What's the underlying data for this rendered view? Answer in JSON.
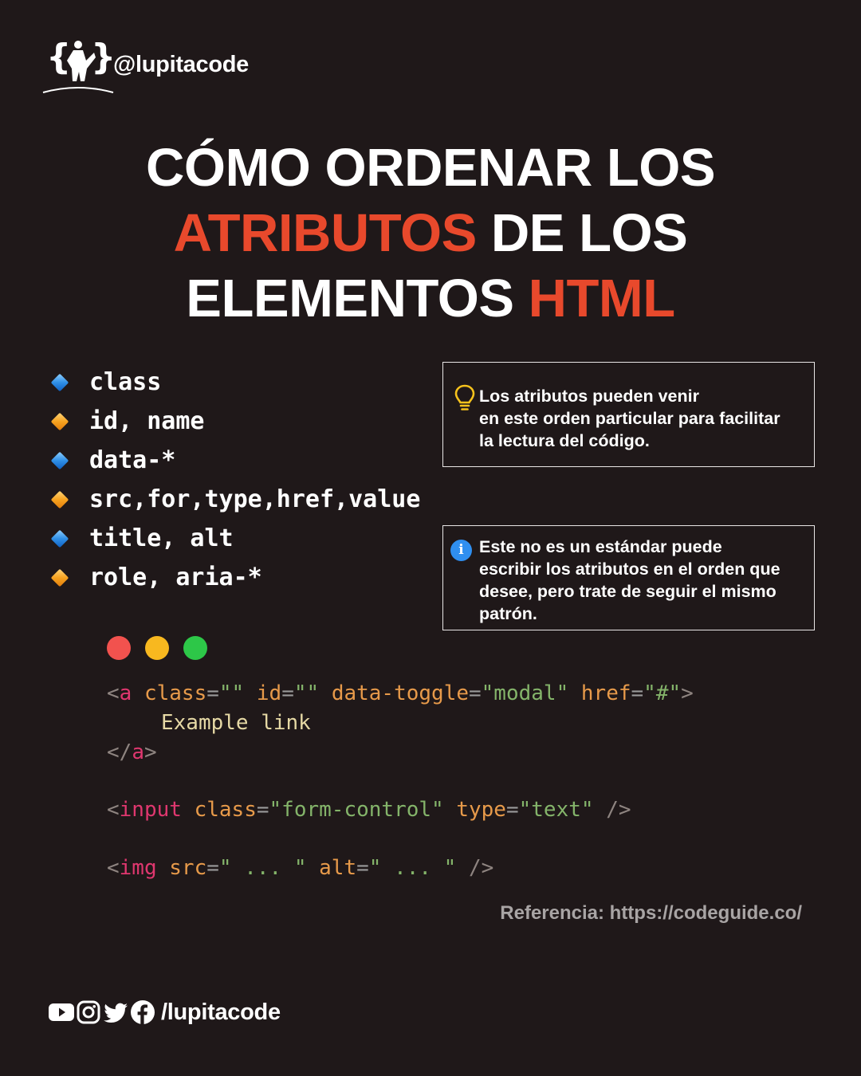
{
  "brand": {
    "handle": "@lupitacode"
  },
  "title": {
    "line1": "CÓMO ORDENAR LOS",
    "line2_accent": "ATRIBUTOS",
    "line2_rest": " DE LOS",
    "line3_rest": "ELEMENTOS ",
    "line3_accent": "HTML"
  },
  "attributes": [
    {
      "text": "class",
      "icon": "blue-diamond-icon"
    },
    {
      "text": "id, name",
      "icon": "orange-diamond-icon"
    },
    {
      "text": "data-*",
      "icon": "blue-diamond-icon"
    },
    {
      "text": "src,for,type,href,value",
      "icon": "orange-diamond-icon"
    },
    {
      "text": "title, alt",
      "icon": "blue-diamond-icon"
    },
    {
      "text": "role, aria-*",
      "icon": "orange-diamond-icon"
    }
  ],
  "tip": {
    "icon": "light-bulb-icon",
    "line1": "Los atributos pueden venir",
    "line2": "en este orden particular para facilitar",
    "line3": "la lectura del código."
  },
  "note": {
    "icon": "info-icon",
    "icon_glyph": "i",
    "line1": "Este no es un estándar puede",
    "line2": "escribir los atributos en el orden que",
    "line3": "desee, pero trate de seguir el mismo",
    "line4": "patrón."
  },
  "code": {
    "line1": {
      "open": "<",
      "tag": "a",
      "a1": "class",
      "eq1": "=",
      "v1": "\"\"",
      "a2": "id",
      "eq2": "=",
      "v2": "\"\"",
      "a3": "data-toggle",
      "eq3": "=",
      "v3": "\"modal\"",
      "a4": "href",
      "eq4": "=",
      "v4": "\"#\"",
      "close": ">"
    },
    "line2": {
      "text": "Example link"
    },
    "line3": {
      "open": "</",
      "tag": "a",
      "close": ">"
    },
    "line4": {
      "open": "<",
      "tag": "input",
      "a1": "class",
      "eq1": "=",
      "v1": "\"form-control\"",
      "a2": "type",
      "eq2": "=",
      "v2": "\"text\"",
      "close": "/>"
    },
    "line5": {
      "open": "<",
      "tag": "img",
      "a1": "src",
      "eq1": "=",
      "v1": "\" ... \"",
      "a2": "alt",
      "eq2": "=",
      "v2": "\" ... \"",
      "close": "/>"
    }
  },
  "reference": "Referencia: https://codeguide.co/",
  "footer": {
    "handle": "/lupitacode",
    "icons": [
      "youtube-icon",
      "instagram-icon",
      "twitter-icon",
      "facebook-icon"
    ]
  },
  "colors": {
    "background": "#1f1819",
    "accent": "#e8492c",
    "tag": "#e0376f",
    "attribute": "#e79a4a",
    "string": "#84b46a",
    "text": "#e6d9a5"
  }
}
